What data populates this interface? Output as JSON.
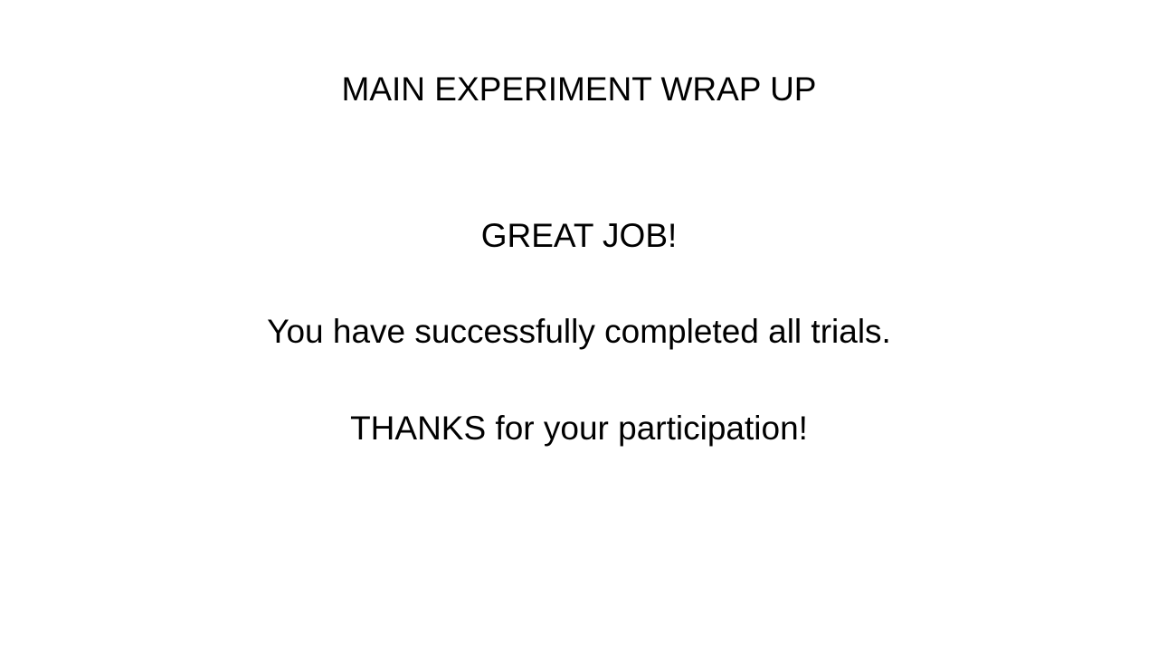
{
  "screen": {
    "heading": "MAIN EXPERIMENT WRAP UP",
    "great_job": "GREAT JOB!",
    "completed_message": "You have successfully completed all trials.",
    "thanks_message": "THANKS for your participation!"
  },
  "colors": {
    "background": "#ffffff",
    "text": "#000000"
  }
}
